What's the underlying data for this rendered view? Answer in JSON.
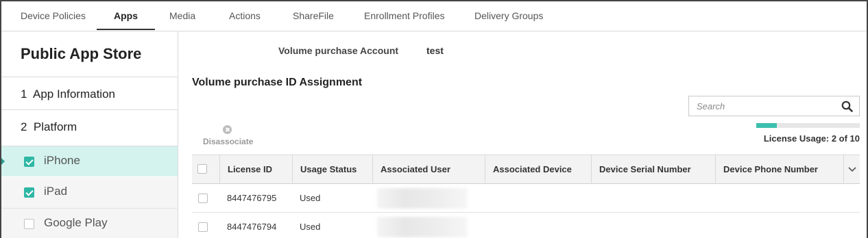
{
  "nav": {
    "tabs": [
      {
        "label": "Device Policies",
        "active": false
      },
      {
        "label": "Apps",
        "active": true
      },
      {
        "label": "Media",
        "active": false
      },
      {
        "label": "Actions",
        "active": false
      },
      {
        "label": "ShareFile",
        "active": false
      },
      {
        "label": "Enrollment Profiles",
        "active": false
      },
      {
        "label": "Delivery Groups",
        "active": false
      }
    ]
  },
  "sidebar": {
    "title": "Public App Store",
    "steps": [
      {
        "number": "1",
        "label": "App Information"
      },
      {
        "number": "2",
        "label": "Platform"
      }
    ],
    "platforms": [
      {
        "label": "iPhone",
        "checked": true,
        "selected": true
      },
      {
        "label": "iPad",
        "checked": true,
        "selected": false
      },
      {
        "label": "Google Play",
        "checked": false,
        "selected": false
      }
    ]
  },
  "main": {
    "account_label": "Volume purchase Account",
    "account_value": "test",
    "section_title": "Volume purchase ID Assignment",
    "search_placeholder": "Search",
    "disassociate_label": "Disassociate",
    "license_usage": {
      "used": 2,
      "total": 10,
      "text": "License Usage: 2 of 10"
    },
    "table": {
      "columns": [
        "License ID",
        "Usage Status",
        "Associated User",
        "Associated Device",
        "Device Serial Number",
        "Device Phone Number"
      ],
      "rows": [
        {
          "license_id": "8447476795",
          "usage_status": "Used"
        },
        {
          "license_id": "8447476794",
          "usage_status": "Used"
        }
      ]
    }
  },
  "colors": {
    "accent": "#3cbfad",
    "selected_row_bg": "#d4f3ee",
    "checkbox_checked": "#2fb7a5"
  },
  "icons": [
    "search-icon",
    "disassociate-icon",
    "checkbox-icon",
    "chevron-down-icon"
  ]
}
